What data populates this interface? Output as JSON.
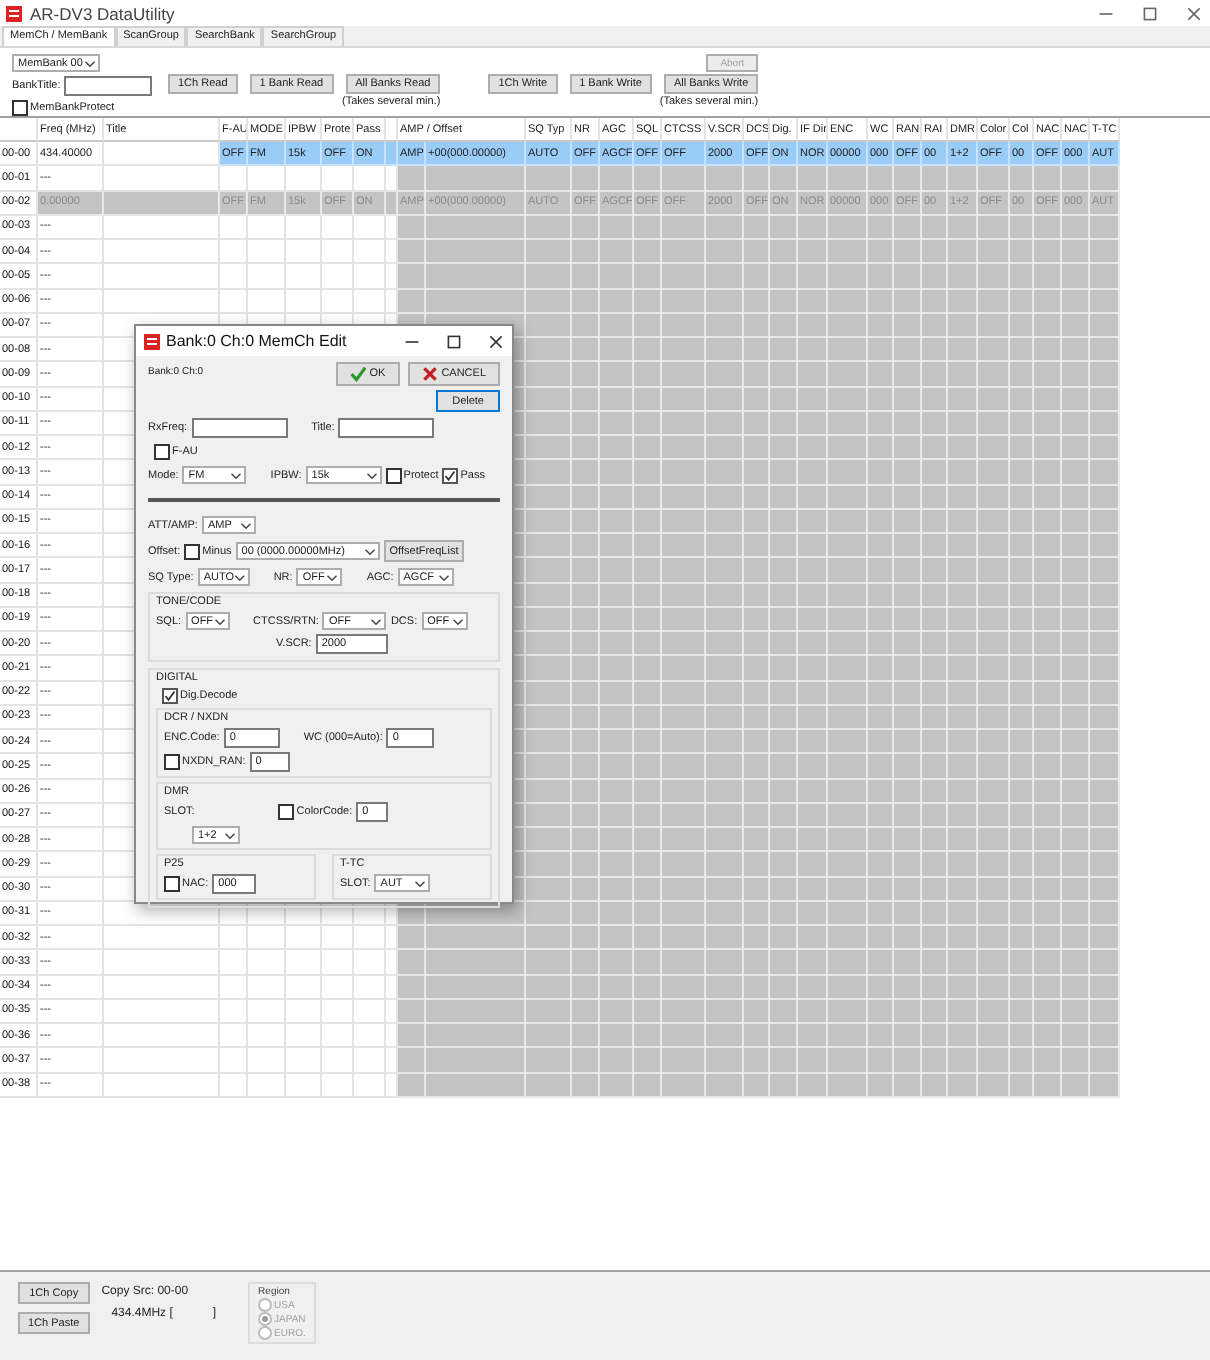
{
  "window": {
    "title": "AR-DV3 DataUtility"
  },
  "tabs": [
    {
      "label": "MemCh / MemBank",
      "selected": true
    },
    {
      "label": "ScanGroup",
      "selected": false
    },
    {
      "label": "SearchBank",
      "selected": false
    },
    {
      "label": "SearchGroup",
      "selected": false
    }
  ],
  "toolbar": {
    "bank_select": "MemBank 00",
    "bank_title_label": "BankTitle:",
    "protect": {
      "label": "MemBankProtect",
      "checked": false
    },
    "read_buttons": [
      "1Ch Read",
      "1 Bank Read",
      "All Banks Read"
    ],
    "read_note": "(Takes several min.)",
    "write_buttons": [
      "1Ch Write",
      "1 Bank Write",
      "All Banks Write"
    ],
    "write_note": "(Takes several min.)",
    "abort": {
      "label": "Abort",
      "disabled": true
    }
  },
  "table": {
    "columns": [
      "Freq (MHz)",
      "Title",
      "F-AU",
      "MODE",
      "IPBW",
      "Prote",
      "Pass",
      "AMP / Offset",
      "SQ Typ",
      "NR",
      "AGC",
      "SQL",
      "CTCSS",
      "V.SCR",
      "DCS",
      "Dig.",
      "IF Dir",
      "ENC",
      "WC",
      "RAN",
      "RAI",
      "DMR",
      "Color",
      "Col",
      "NAC",
      "NAC",
      "T-TC"
    ],
    "rows": [
      {
        "ch": "00-00",
        "kind": "data",
        "selected": true,
        "freq": "434.40000",
        "values": [
          "OFF",
          "FM",
          "15k",
          "OFF",
          "ON",
          "AMP",
          "+00(000.00000)",
          "AUTO",
          "OFF",
          "AGCF",
          "OFF",
          "OFF",
          "2000",
          "OFF",
          "ON",
          "NOR",
          "00000",
          "000",
          "OFF",
          "00",
          "1+2",
          "OFF",
          "00",
          "OFF",
          "000",
          "AUT"
        ]
      },
      {
        "ch": "00-01",
        "kind": "empty",
        "selected": false,
        "freq": "---"
      },
      {
        "ch": "00-02",
        "kind": "disabled",
        "selected": false,
        "freq": "0.00000",
        "values": [
          "OFF",
          "FM",
          "15k",
          "OFF",
          "ON",
          "AMP",
          "+00(000.00000)",
          "AUTO",
          "OFF",
          "AGCF",
          "OFF",
          "OFF",
          "2000",
          "OFF",
          "ON",
          "NOR",
          "00000",
          "000",
          "OFF",
          "00",
          "1+2",
          "OFF",
          "00",
          "OFF",
          "000",
          "AUT"
        ]
      },
      {
        "ch": "00-03",
        "kind": "empty",
        "selected": false,
        "freq": "---"
      },
      {
        "ch": "00-04",
        "kind": "empty",
        "selected": false,
        "freq": "---"
      },
      {
        "ch": "00-05",
        "kind": "empty",
        "selected": false,
        "freq": "---"
      },
      {
        "ch": "00-06",
        "kind": "empty",
        "selected": false,
        "freq": "---"
      },
      {
        "ch": "00-07",
        "kind": "empty",
        "selected": false,
        "freq": "---"
      },
      {
        "ch": "00-08",
        "kind": "empty",
        "selected": false,
        "freq": "---"
      },
      {
        "ch": "00-09",
        "kind": "empty",
        "selected": false,
        "freq": "---"
      },
      {
        "ch": "00-10",
        "kind": "empty",
        "selected": false,
        "freq": "---"
      },
      {
        "ch": "00-11",
        "kind": "empty",
        "selected": false,
        "freq": "---"
      },
      {
        "ch": "00-12",
        "kind": "empty",
        "selected": false,
        "freq": "---"
      },
      {
        "ch": "00-13",
        "kind": "empty",
        "selected": false,
        "freq": "---"
      },
      {
        "ch": "00-14",
        "kind": "empty",
        "selected": false,
        "freq": "---"
      },
      {
        "ch": "00-15",
        "kind": "empty",
        "selected": false,
        "freq": "---"
      },
      {
        "ch": "00-16",
        "kind": "empty",
        "selected": false,
        "freq": "---"
      },
      {
        "ch": "00-17",
        "kind": "empty",
        "selected": false,
        "freq": "---"
      },
      {
        "ch": "00-18",
        "kind": "empty",
        "selected": false,
        "freq": "---"
      },
      {
        "ch": "00-19",
        "kind": "empty",
        "selected": false,
        "freq": "---"
      },
      {
        "ch": "00-20",
        "kind": "empty",
        "selected": false,
        "freq": "---"
      },
      {
        "ch": "00-21",
        "kind": "empty",
        "selected": false,
        "freq": "---"
      },
      {
        "ch": "00-22",
        "kind": "empty",
        "selected": false,
        "freq": "---"
      },
      {
        "ch": "00-23",
        "kind": "empty",
        "selected": false,
        "freq": "---"
      },
      {
        "ch": "00-24",
        "kind": "empty",
        "selected": false,
        "freq": "---"
      },
      {
        "ch": "00-25",
        "kind": "empty",
        "selected": false,
        "freq": "---"
      },
      {
        "ch": "00-26",
        "kind": "empty",
        "selected": false,
        "freq": "---"
      },
      {
        "ch": "00-27",
        "kind": "empty",
        "selected": false,
        "freq": "---"
      },
      {
        "ch": "00-28",
        "kind": "empty",
        "selected": false,
        "freq": "---"
      },
      {
        "ch": "00-29",
        "kind": "empty",
        "selected": false,
        "freq": "---"
      },
      {
        "ch": "00-30",
        "kind": "empty",
        "selected": false,
        "freq": "---"
      },
      {
        "ch": "00-31",
        "kind": "empty",
        "selected": false,
        "freq": "---"
      },
      {
        "ch": "00-32",
        "kind": "empty",
        "selected": false,
        "freq": "---"
      },
      {
        "ch": "00-33",
        "kind": "empty",
        "selected": false,
        "freq": "---"
      },
      {
        "ch": "00-34",
        "kind": "empty",
        "selected": false,
        "freq": "---"
      },
      {
        "ch": "00-35",
        "kind": "empty",
        "selected": false,
        "freq": "---"
      },
      {
        "ch": "00-36",
        "kind": "empty",
        "selected": false,
        "freq": "---"
      },
      {
        "ch": "00-37",
        "kind": "empty",
        "selected": false,
        "freq": "---"
      },
      {
        "ch": "00-38",
        "kind": "empty",
        "selected": false,
        "freq": "---"
      }
    ]
  },
  "bottom": {
    "copy_button": "1Ch Copy",
    "paste_button": "1Ch Paste",
    "copy_src": "Copy Src: 00-00",
    "copy_freq": "434.4MHz [",
    "copy_end": "]",
    "region": {
      "title": "Region",
      "disabled": true,
      "options": [
        {
          "label": "USA",
          "selected": false
        },
        {
          "label": "JAPAN",
          "selected": true
        },
        {
          "label": "EURO.",
          "selected": false
        }
      ]
    }
  },
  "dialog": {
    "title": "Bank:0 Ch:0  MemCh Edit",
    "subtitle": "Bank:0 Ch:0",
    "buttons": [
      {
        "label": "OK",
        "kind": "ok"
      },
      {
        "label": "CANCEL",
        "kind": "cancel"
      }
    ],
    "delete_button": "Delete",
    "rx_freq": {
      "label": "RxFreq:"
    },
    "title_field": {
      "label": "Title:"
    },
    "f_au": {
      "label": "F-AU",
      "checked": false
    },
    "mode": {
      "label": "Mode:",
      "value": "FM"
    },
    "ipbw": {
      "label": "IPBW:",
      "value": "15k"
    },
    "protect": {
      "label": "Protect",
      "checked": false
    },
    "pass": {
      "label": "Pass",
      "checked": true
    },
    "att_amp": {
      "label": "ATT/AMP:",
      "value": "AMP"
    },
    "offset": {
      "label": "Offset:",
      "value": "00 (0000.00000MHz)"
    },
    "minus": {
      "label": "Minus",
      "checked": false
    },
    "offset_list_button": "OffsetFreqList",
    "sq_type": {
      "label": "SQ Type:",
      "value": "AUTO"
    },
    "nr": {
      "label": "NR:",
      "value": "OFF"
    },
    "agc": {
      "label": "AGC:",
      "value": "AGCF"
    },
    "tone_code": {
      "title": "TONE/CODE",
      "sql": {
        "label": "SQL:",
        "value": "OFF"
      },
      "ctcss": {
        "label": "CTCSS/RTN:",
        "value": "OFF"
      },
      "dcs": {
        "label": "DCS:",
        "value": "OFF"
      },
      "vscr": {
        "label": "V.SCR:",
        "value": "2000"
      }
    },
    "digital": {
      "title": "DIGITAL",
      "dig_decode": {
        "label": "Dig.Decode",
        "checked": true
      },
      "dcr_nxdn": {
        "title": "DCR / NXDN",
        "enc_code": {
          "label": "ENC.Code:",
          "value": "0"
        },
        "wc": {
          "label": "WC (000=Auto):",
          "value": "0"
        },
        "nxdn_ran": {
          "label": "NXDN_RAN:",
          "checked": false,
          "value": "0"
        }
      },
      "dmr": {
        "title": "DMR",
        "slot": {
          "label": "SLOT:",
          "value": "1+2"
        },
        "color_code": {
          "label": "ColorCode:",
          "checked": false,
          "value": "0"
        }
      },
      "p25": {
        "title": "P25",
        "nac": {
          "label": "NAC:",
          "checked": false,
          "value": "000"
        }
      },
      "ttc": {
        "title": "T-TC",
        "slot": {
          "label": "SLOT:",
          "value": "AUT"
        }
      }
    }
  }
}
